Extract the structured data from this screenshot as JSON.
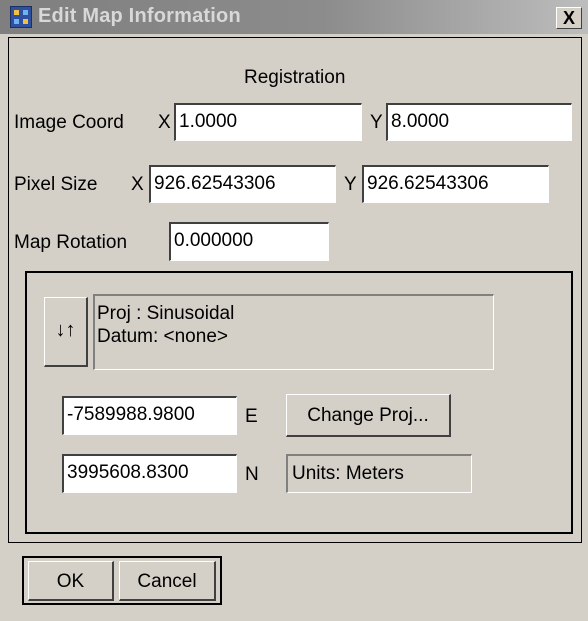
{
  "window": {
    "title": "Edit Map Information",
    "close_glyph": "X",
    "icon": "map-window-icon"
  },
  "registration": {
    "heading": "Registration",
    "image_coord": {
      "label": "Image Coord",
      "x_label": "X",
      "x_value": "1.0000",
      "y_label": "Y",
      "y_value": "8.0000"
    },
    "pixel_size": {
      "label": "Pixel Size",
      "x_label": "X",
      "x_value": "926.62543306",
      "y_label": "Y",
      "y_value": "926.62543306"
    },
    "map_rotation": {
      "label": "Map Rotation",
      "value": "0.000000"
    }
  },
  "projection": {
    "toggle_icon": "swap-arrows-icon",
    "toggle_glyph": "↓↑",
    "proj_line": "Proj : Sinusoidal",
    "datum_line": "Datum: <none>",
    "easting": {
      "value": "-7589988.9800",
      "suffix": "E"
    },
    "northing": {
      "value": "3995608.8300",
      "suffix": "N"
    },
    "change_proj_label": "Change Proj...",
    "units_label": "Units: Meters"
  },
  "buttons": {
    "ok_label": "OK",
    "cancel_label": "Cancel"
  },
  "colors": {
    "dialog_bg": "#d4d0c8",
    "title_bar": "#808080",
    "title_text": "#d8d8d8"
  }
}
